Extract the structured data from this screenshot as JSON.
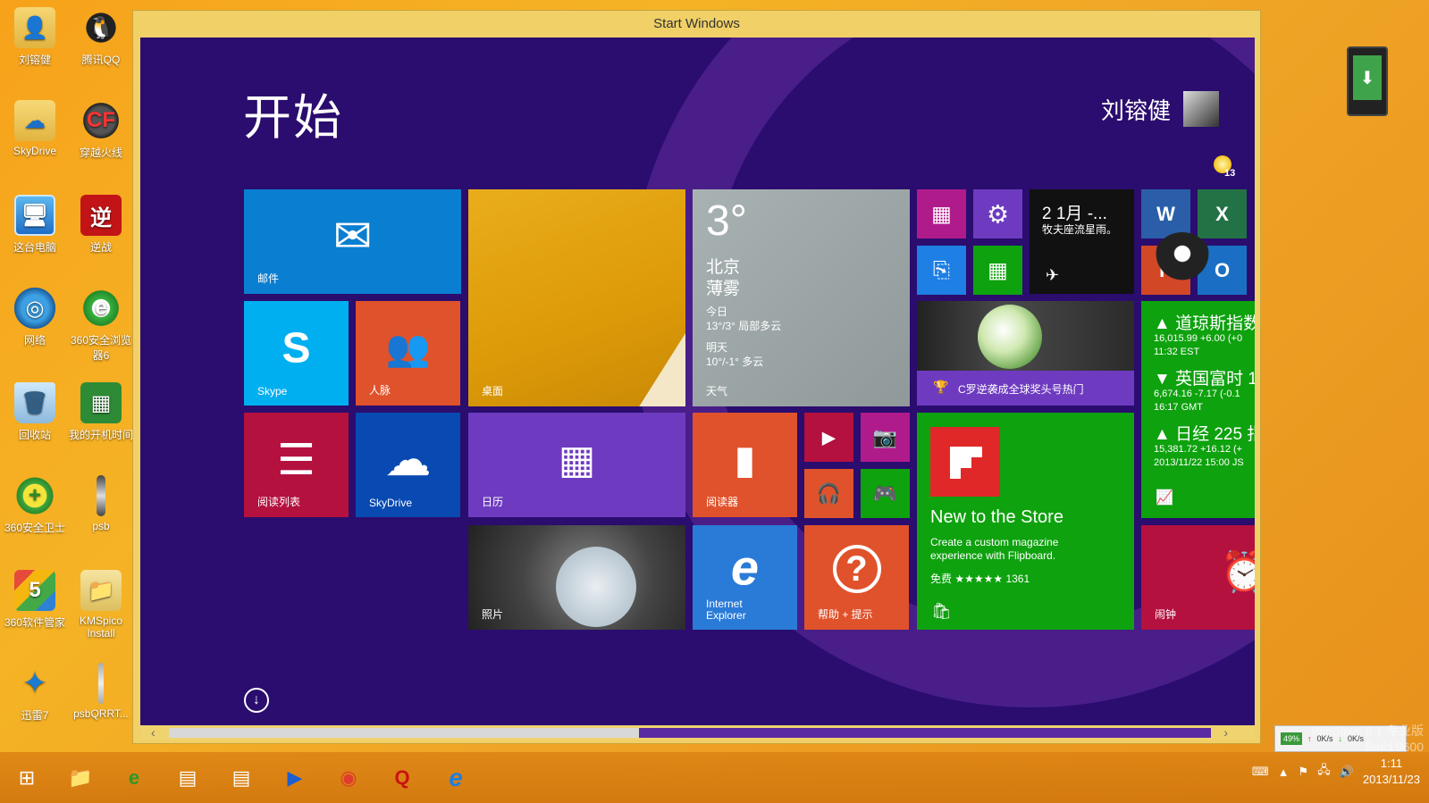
{
  "window": {
    "title": "Start Windows"
  },
  "desktop_icons": [
    {
      "id": "liu",
      "label": "刘镕健",
      "glyph": "👤"
    },
    {
      "id": "qq",
      "label": "腾讯QQ",
      "glyph": "🐧"
    },
    {
      "id": "skydrive",
      "label": "SkyDrive",
      "glyph": "☁"
    },
    {
      "id": "cf",
      "label": "穿越火线",
      "glyph": "CF"
    },
    {
      "id": "pc",
      "label": "这台电脑",
      "glyph": "🖥"
    },
    {
      "id": "nz",
      "label": "逆战",
      "glyph": "逆"
    },
    {
      "id": "net",
      "label": "网络",
      "glyph": "◎"
    },
    {
      "id": "b360",
      "label": "360安全浏览器6",
      "glyph": "e"
    },
    {
      "id": "bin",
      "label": "回收站",
      "glyph": "🗑"
    },
    {
      "id": "boottime",
      "label": "我的开机时间",
      "glyph": "▦"
    },
    {
      "id": "guard",
      "label": "360安全卫士",
      "glyph": "+"
    },
    {
      "id": "psb",
      "label": "psb",
      "glyph": ""
    },
    {
      "id": "mgr",
      "label": "360软件管家",
      "glyph": "5"
    },
    {
      "id": "kms",
      "label": "KMSpico Install",
      "glyph": "📁"
    },
    {
      "id": "thunder",
      "label": "迅雷7",
      "glyph": "✦"
    },
    {
      "id": "psbq",
      "label": "psbQRRT...",
      "glyph": ""
    }
  ],
  "start": {
    "title": "开始",
    "user_name": "刘镕健",
    "notification_count": "13",
    "tiles": {
      "mail": {
        "label": "邮件",
        "glyph": "✉",
        "color": "#0a7fd1"
      },
      "desktop": {
        "label": "桌面",
        "color": "#e8a50b"
      },
      "weather": {
        "label": "天气",
        "temp": "3°",
        "city": "北京",
        "condition": "薄雾",
        "today_label": "今日",
        "today": "13°/3° 局部多云",
        "tomorrow_label": "明天",
        "tomorrow": "10°/-1° 多云",
        "color": "#9ea8a9"
      },
      "skype": {
        "label": "Skype",
        "glyph": "S",
        "color": "#00aff0"
      },
      "people": {
        "label": "人脉",
        "glyph": "👥",
        "color": "#e0522b"
      },
      "reading_list": {
        "label": "阅读列表",
        "glyph": "☰",
        "color": "#b4113f"
      },
      "skydrive": {
        "label": "SkyDrive",
        "glyph": "☁",
        "color": "#094ab2"
      },
      "calendar": {
        "label": "日历",
        "glyph": "▦",
        "color": "#6e3bc0"
      },
      "reader": {
        "label": "阅读器",
        "glyph": "▮",
        "color": "#e0522b"
      },
      "photos": {
        "label": "照片",
        "color": "#555"
      },
      "ie": {
        "label": "Internet Explorer",
        "glyph": "e",
        "color": "#2a7bd8"
      },
      "help": {
        "label": "帮助 + 提示",
        "glyph": "?",
        "color": "#e0522b"
      },
      "video": {
        "glyph": "▶",
        "color": "#b4113f"
      },
      "camera": {
        "glyph": "📷",
        "color": "#b01b8c"
      },
      "music": {
        "glyph": "🎧",
        "color": "#e0522b"
      },
      "games": {
        "glyph": "🎮",
        "color": "#0ea20e"
      },
      "office": {
        "glyph": "▦",
        "color": "#b01b8c"
      },
      "settings": {
        "glyph": "⚙",
        "color": "#6e3bc0"
      },
      "scanner": {
        "glyph": "⎘",
        "color": "#1e7fe5"
      },
      "calculator": {
        "glyph": "▦",
        "color": "#0ea20e"
      },
      "astro": {
        "line1": "2 1月 -...",
        "line2": "牧夫座流星雨。",
        "color": "#111"
      },
      "word": {
        "glyph": "W",
        "color": "#2a5ea9"
      },
      "excel": {
        "glyph": "X",
        "color": "#237246"
      },
      "outlook": {
        "glyph": "O",
        "color": "#1a6fc4"
      },
      "powerpoint": {
        "glyph": "P",
        "color": "#d24726"
      },
      "sports": {
        "caption": "C罗逆袭成全球奖头号热门",
        "color": "#6e3bc0"
      },
      "store": {
        "title": "New to the Store",
        "desc": "Create a custom magazine experience with Flipboard.",
        "rating": "免费 ★★★★★ 1361",
        "color": "#0ea20e"
      },
      "finance": {
        "color": "#0ea20e",
        "rows": [
          {
            "name": "▲ 道琼斯指数",
            "value": "16,015.99 +6.00 (+0",
            "time": "11:32 EST"
          },
          {
            "name": "▼ 英国富时 1",
            "value": "6,674.16 -7.17 (-0.1",
            "time": "16:17 GMT"
          },
          {
            "name": "▲ 日经 225 指",
            "value": "15,381.72 +16.12 (+",
            "time": "2013/11/22 15:00 JS"
          }
        ]
      },
      "alarm": {
        "label": "闹钟",
        "glyph": "⏰",
        "color": "#b4113f"
      }
    }
  },
  "taskbar": {
    "items": [
      {
        "id": "start-btn",
        "glyph": "⊞"
      },
      {
        "id": "explorer",
        "glyph": "📁"
      },
      {
        "id": "browser360",
        "glyph": "e"
      },
      {
        "id": "app1",
        "glyph": "▤"
      },
      {
        "id": "app2",
        "glyph": "▤"
      },
      {
        "id": "player",
        "glyph": "▶"
      },
      {
        "id": "chrome",
        "glyph": "◉"
      },
      {
        "id": "appq",
        "glyph": "Q"
      },
      {
        "id": "ie",
        "glyph": "e"
      }
    ],
    "clock_time": "1:11",
    "clock_date": "2013/11/23"
  },
  "net_meter": {
    "percent": "49%",
    "up": "0K/s",
    "down": "0K/s"
  },
  "watermark": {
    "line1": "Windows 8.1 专业版",
    "line2": "Build 9600"
  }
}
